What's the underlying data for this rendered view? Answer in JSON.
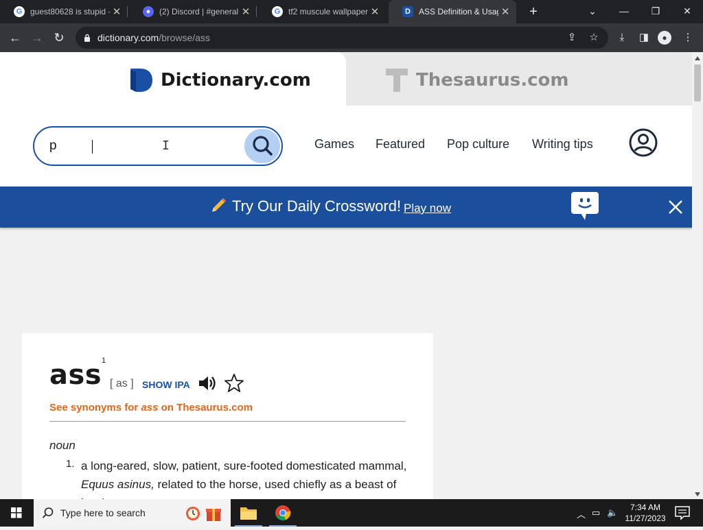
{
  "browser": {
    "tabs": [
      {
        "title": "guest80628 is stupid -",
        "icon": "google-icon",
        "close": "✕"
      },
      {
        "title": "(2) Discord | #general",
        "icon": "discord-icon",
        "close": "✕"
      },
      {
        "title": "tf2 muscule wallpaper",
        "icon": "google-icon",
        "close": "✕"
      },
      {
        "title": "ASS Definition & Usag",
        "icon": "dictionary-icon",
        "close": "✕"
      }
    ],
    "url_domain": "dictionary.com",
    "url_path": "/browse/ass"
  },
  "site": {
    "dictionary_brand": "Dictionary.com",
    "thesaurus_brand": "Thesaurus.com",
    "search": {
      "value": "p"
    },
    "nav": [
      "Games",
      "Featured",
      "Pop culture",
      "Writing tips"
    ],
    "banner": {
      "message": "Try Our Daily Crossword!",
      "link": "Play now"
    },
    "colors": {
      "brand_blue": "#1a4fa3",
      "banner_blue": "#1c4f9b",
      "accent_orange": "#e0661b"
    }
  },
  "entry": {
    "word": "ass",
    "superscript": "1",
    "pronunciation": "[ as ]",
    "show_ipa": "SHOW IPA",
    "synonyms_prefix": "See synonyms for ",
    "synonyms_word": "ass",
    "synonyms_suffix": " on Thesaurus.com",
    "part_of_speech": "noun",
    "definition_number": "1.",
    "definition_a": "a long-eared, slow, patient, sure-footed domesticated mammal, ",
    "definition_em": "Equus asinus,",
    "definition_b": " related to the horse, used chiefly as a beast of burden."
  },
  "taskbar": {
    "search_placeholder": "Type here to search",
    "time": "7:34 AM",
    "date": "11/27/2023"
  }
}
